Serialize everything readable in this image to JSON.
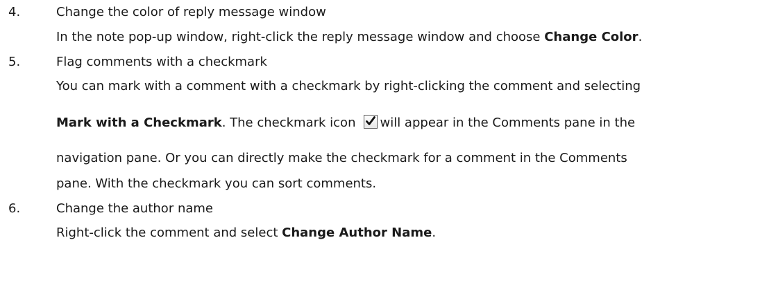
{
  "items": [
    {
      "number": "4.",
      "heading": "Change the color of reply message window",
      "body": {
        "pre": "In the note pop-up window, right-click the reply message window and choose ",
        "bold": "Change Color",
        "post": "."
      }
    },
    {
      "number": "5.",
      "heading": "Flag comments with a checkmark",
      "line1": "You can mark with a comment with a checkmark by right-clicking the comment and selecting",
      "line2": {
        "bold": "Mark with a Checkmark",
        "pre_icon": ". The checkmark icon",
        "icon": "checkmark-checkbox-icon",
        "post_icon": "will appear in the Comments pane in the"
      },
      "line3": "navigation pane. Or you can directly make the checkmark for a comment in the Comments",
      "line4": "pane. With the checkmark you can sort comments."
    },
    {
      "number": "6.",
      "heading": "Change the author name",
      "body": {
        "pre": "Right-click the comment and select ",
        "bold": "Change Author Name",
        "post": "."
      }
    }
  ]
}
